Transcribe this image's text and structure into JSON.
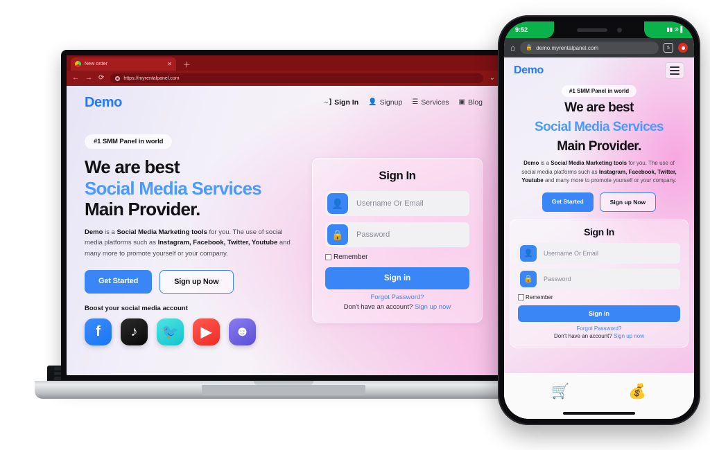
{
  "laptop": {
    "browser": {
      "tab_title": "New order",
      "tab_close": "✕",
      "new_tab": "＋",
      "back": "←",
      "forward": "→",
      "reload": "⟳",
      "url": "https://myrentalpanel.com",
      "menu": "⌄"
    },
    "site": {
      "brand": "Demo",
      "nav": [
        {
          "icon": "→]",
          "label": "Sign In",
          "active": true
        },
        {
          "icon": "👤",
          "label": "Signup",
          "active": false
        },
        {
          "icon": "☰",
          "label": "Services",
          "active": false
        },
        {
          "icon": "▣",
          "label": "Blog",
          "active": false
        }
      ],
      "hero": {
        "pill": "#1 SMM Panel in world",
        "line1": "We are best",
        "line2": "Social Media Services",
        "line3": "Main Provider.",
        "paragraph_parts": [
          {
            "text": "Demo",
            "bold": true
          },
          {
            "text": " is a ",
            "bold": false
          },
          {
            "text": "Social Media Marketing tools",
            "bold": true
          },
          {
            "text": " for you. The use of social media platforms such as ",
            "bold": false
          },
          {
            "text": "Instagram, Facebook, Twitter, Youtube",
            "bold": true
          },
          {
            "text": " and many more to promote yourself or your company.",
            "bold": false
          }
        ],
        "btn_primary": "Get Started",
        "btn_outline": "Sign up Now",
        "boost_label": "Boost your social media account",
        "socials": [
          {
            "name": "facebook",
            "glyph": "f",
            "class": "fb"
          },
          {
            "name": "tiktok",
            "glyph": "♪",
            "class": "tt"
          },
          {
            "name": "twitter",
            "glyph": "🐦",
            "class": "tw"
          },
          {
            "name": "youtube",
            "glyph": "▶",
            "class": "yt"
          },
          {
            "name": "discord",
            "glyph": "☻",
            "class": "dc"
          }
        ]
      },
      "signin": {
        "title": "Sign In",
        "user_icon": "👤",
        "user_placeholder": "Username Or Email",
        "lock_icon": "🔒",
        "password_placeholder": "Password",
        "remember": "Remember",
        "submit": "Sign in",
        "forgot": "Forgot Password?",
        "no_account_text": "Don't have an account? ",
        "signup_link": "Sign up now"
      }
    }
  },
  "phone": {
    "status": {
      "time": "9:52",
      "icons": "▮▮ ⊘ ▌"
    },
    "browser": {
      "home_icon": "⌂",
      "lock_icon": "🔒",
      "url": "demo.myrentalpanel.com",
      "tab_count": "5",
      "menu": "menu-dot"
    },
    "site": {
      "brand": "Demo",
      "hero": {
        "pill": "#1 SMM Panel in world",
        "line1": "We are best",
        "line2": "Social Media Services",
        "line3": "Main Provider.",
        "paragraph_parts": [
          {
            "text": "Demo",
            "bold": true
          },
          {
            "text": " is a ",
            "bold": false
          },
          {
            "text": "Social Media Marketing tools",
            "bold": true
          },
          {
            "text": " for you. The use of social media platforms such as ",
            "bold": false
          },
          {
            "text": "Instagram, Facebook, Twitter, Youtube",
            "bold": true
          },
          {
            "text": " and many more to promote yourself or your company.",
            "bold": false
          }
        ],
        "btn_primary": "Get Started",
        "btn_outline": "Sign up Now"
      },
      "signin": {
        "title": "Sign In",
        "user_icon": "👤",
        "user_placeholder": "Username Or Email",
        "lock_icon": "🔒",
        "password_placeholder": "Password",
        "remember": "Remember",
        "submit": "Sign in",
        "forgot": "Forgot Password?",
        "no_account_text": "Don't have an account? ",
        "signup_link": "Sign up now"
      },
      "bottom_emojis": [
        "🛒",
        "💰"
      ]
    }
  },
  "colors": {
    "accent_blue": "#3b86f7",
    "link_blue": "#4b9bff",
    "browser_red": "#8c1517",
    "status_green": "#0bb14b"
  }
}
